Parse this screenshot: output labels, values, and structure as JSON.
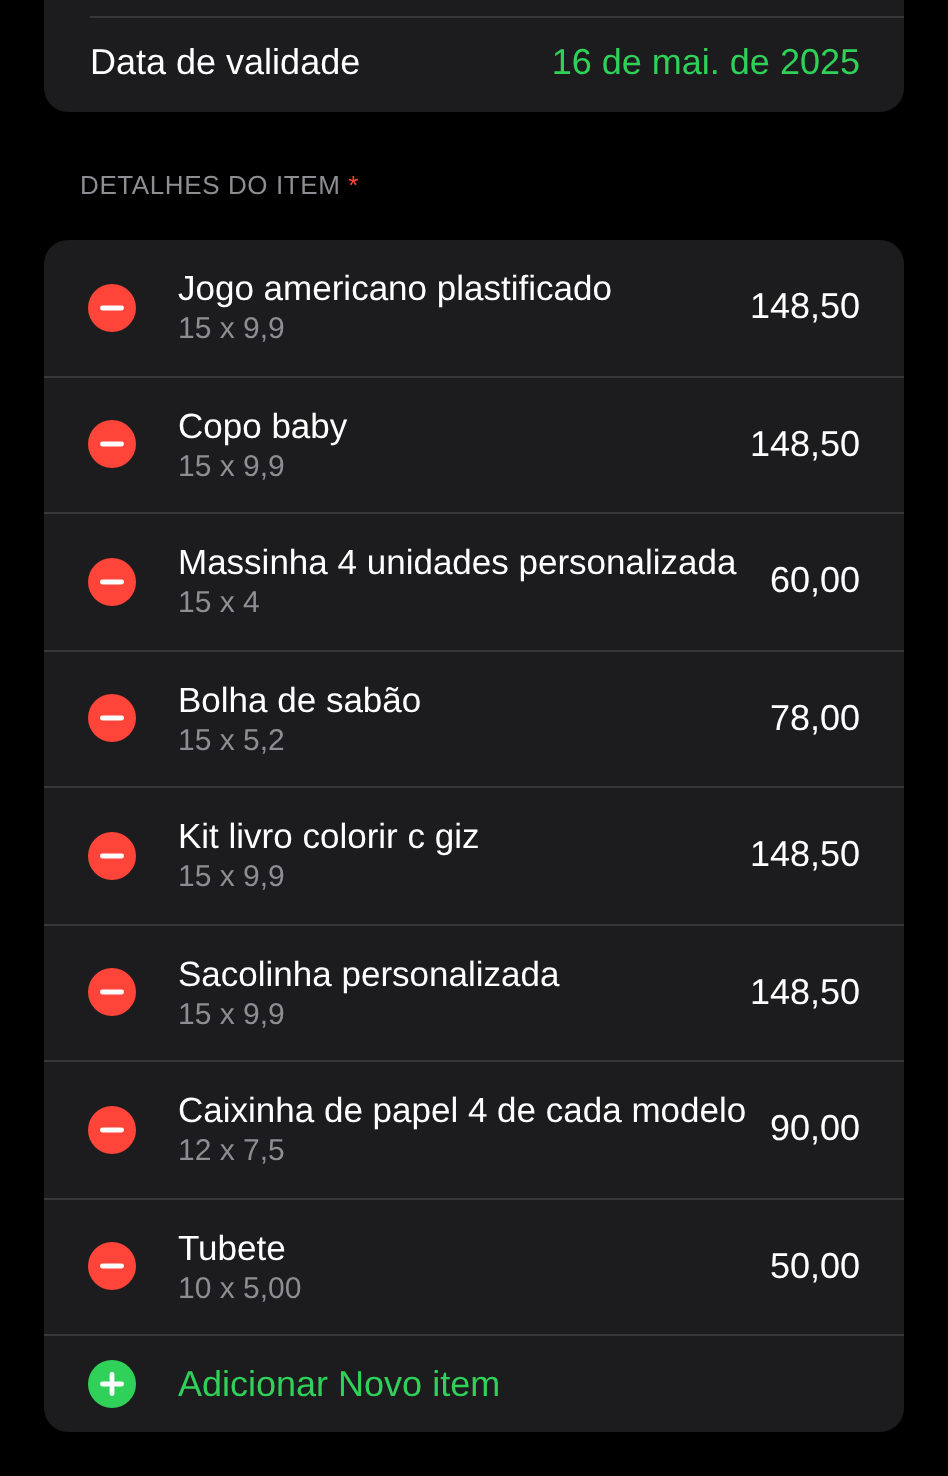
{
  "validity": {
    "label": "Data de validade",
    "value": "16 de mai. de 2025"
  },
  "section": {
    "title": "DETALHES DO ITEM",
    "required_mark": "*"
  },
  "items": [
    {
      "name": "Jogo americano plastificado",
      "size": "15 x 9,9",
      "price": "148,50"
    },
    {
      "name": "Copo baby",
      "size": "15 x 9,9",
      "price": "148,50"
    },
    {
      "name": "Massinha 4 unidades personalizada",
      "size": "15 x 4",
      "price": "60,00"
    },
    {
      "name": "Bolha de sabão",
      "size": "15 x 5,2",
      "price": "78,00"
    },
    {
      "name": "Kit livro colorir c giz",
      "size": "15 x 9,9",
      "price": "148,50"
    },
    {
      "name": "Sacolinha personalizada",
      "size": "15 x 9,9",
      "price": "148,50"
    },
    {
      "name": "Caixinha de papel 4 de cada modelo",
      "size": "12 x 7,5",
      "price": "90,00"
    },
    {
      "name": "Tubete",
      "size": "10 x 5,00",
      "price": "50,00"
    }
  ],
  "add_button": {
    "label": "Adicionar Novo item"
  }
}
